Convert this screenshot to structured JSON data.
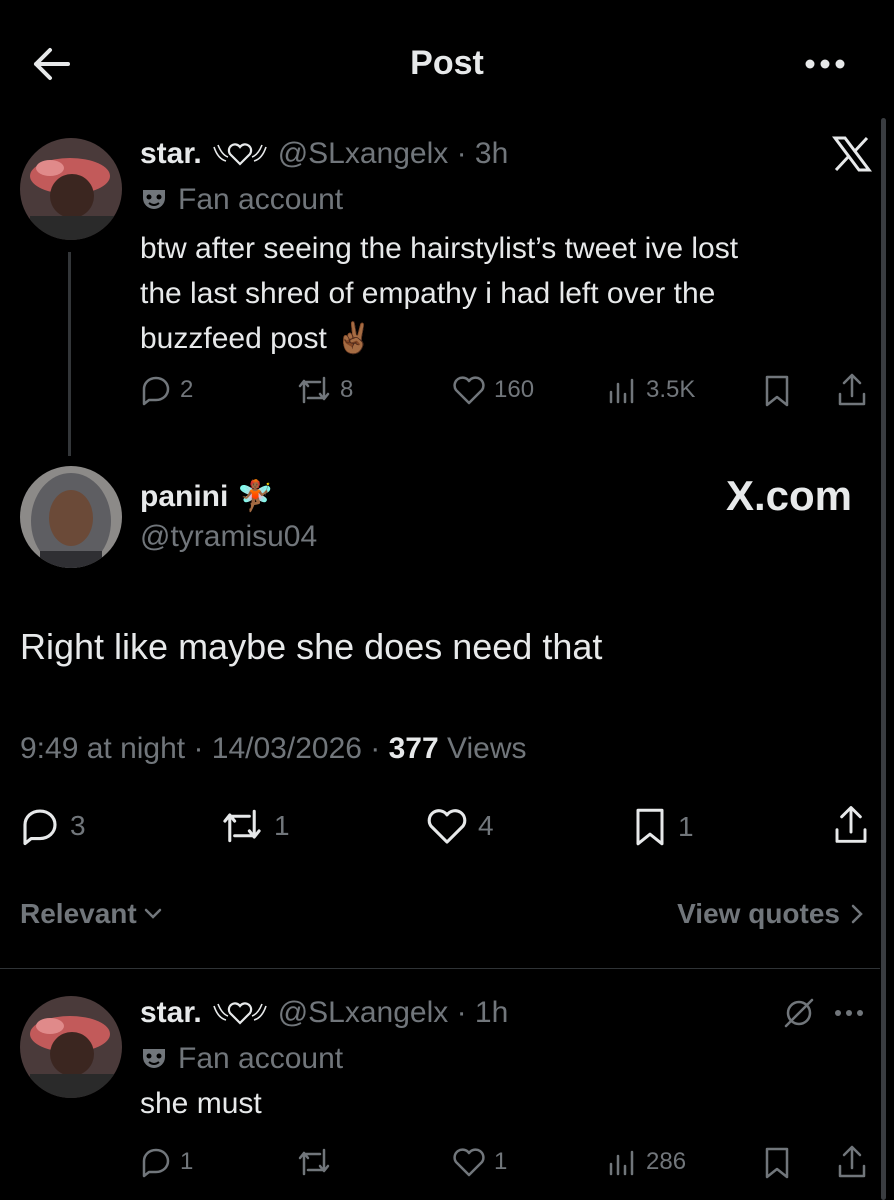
{
  "header": {
    "title": "Post"
  },
  "parent_post": {
    "display_name": "star.",
    "handle_time": "@SLxangelx · 3h",
    "label": "Fan account",
    "text_lines": [
      "btw after seeing the hairstylist’s tweet ive lost",
      "the last shred of empathy i had left over the",
      "buzzfeed post ✌🏾"
    ],
    "replies": "2",
    "reposts": "8",
    "likes": "160",
    "views": "3.5K"
  },
  "main_post": {
    "display_name": "panini 🧚🏾",
    "handle": "@tyramisu04",
    "watermark": "X.com",
    "text": "Right like maybe she does need that",
    "meta_time": "9:49 at night · 14/03/2026 · ",
    "meta_views_count": "377",
    "meta_views_label": " Views",
    "replies": "3",
    "reposts": "1",
    "likes": "4",
    "bookmarks": "1"
  },
  "sort": {
    "label": "Relevant",
    "view_quotes": "View quotes"
  },
  "reply_post": {
    "display_name": "star.",
    "handle_time": "@SLxangelx · 1h",
    "label": "Fan account",
    "text": "she must",
    "replies": "1",
    "likes": "1",
    "views": "286"
  },
  "colors": {
    "background": "#000000",
    "text": "#e7e9ea",
    "muted": "#71767b",
    "divider": "#2f3336"
  },
  "icons": [
    "back-arrow-icon",
    "more-icon",
    "x-logo-icon",
    "mask-icon",
    "reply-icon",
    "repost-icon",
    "like-icon",
    "views-icon",
    "bookmark-icon",
    "share-icon",
    "grok-icon",
    "chevron-down-icon",
    "chevron-right-icon"
  ]
}
